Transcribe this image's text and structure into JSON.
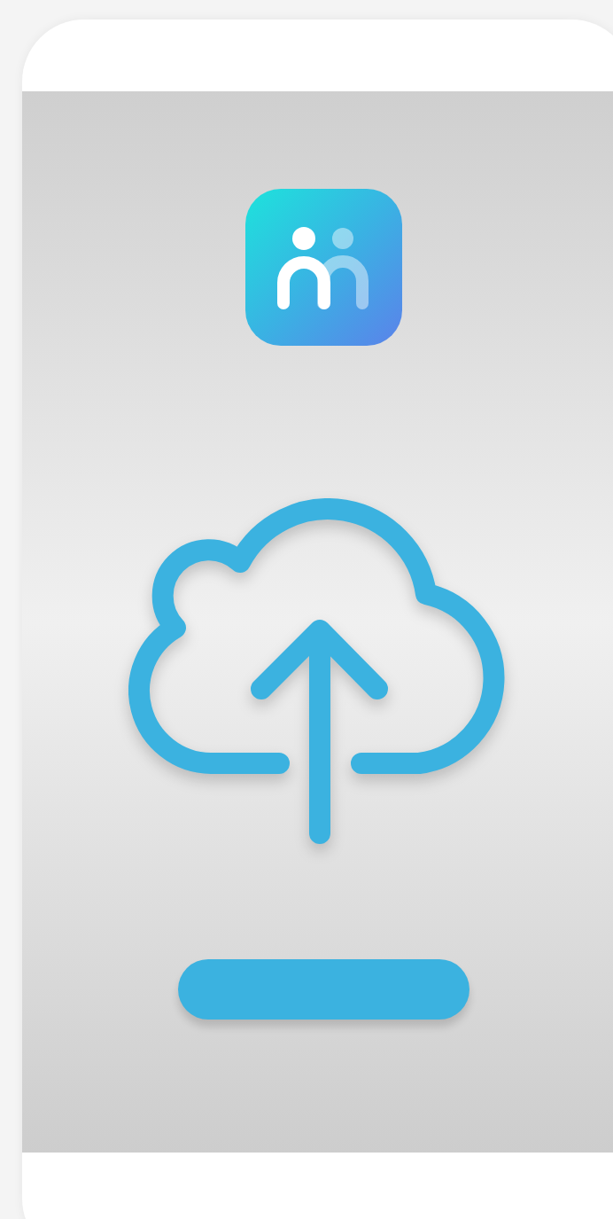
{
  "screen": {
    "kind": "upload"
  }
}
